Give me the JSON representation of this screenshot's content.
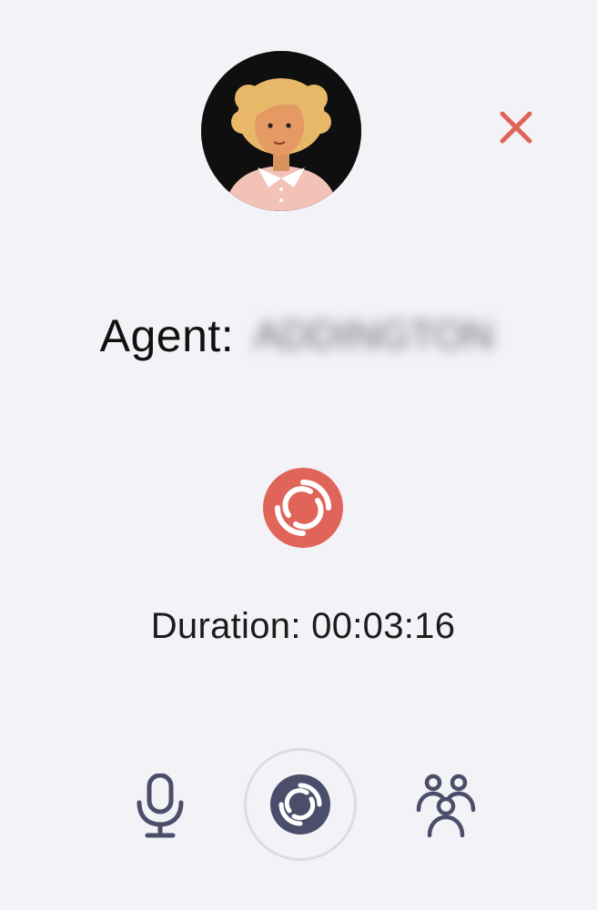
{
  "call": {
    "agent_label": "Agent:",
    "agent_name": "ADDINGTON",
    "duration_text": "Duration: 00:03:16"
  },
  "icons": {
    "avatar": "agent-avatar",
    "close": "close-icon",
    "status": "call-in-progress-icon",
    "mic": "microphone-icon",
    "center": "hangup-icon",
    "participants": "participants-icon"
  },
  "colors": {
    "background": "#f2f2f7",
    "accent": "#e06459",
    "control": "#4a4e6b"
  }
}
